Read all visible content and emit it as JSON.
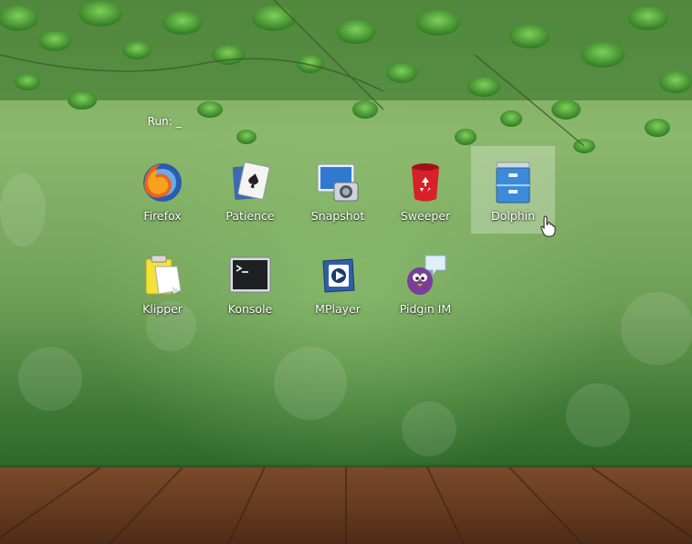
{
  "run_prompt": {
    "label": "Run:",
    "cursor": "_"
  },
  "apps": [
    {
      "name": "Firefox",
      "icon": "firefox-icon"
    },
    {
      "name": "Patience",
      "icon": "playing-card-icon"
    },
    {
      "name": "Snapshot",
      "icon": "camera-monitor-icon"
    },
    {
      "name": "Sweeper",
      "icon": "recycle-bin-icon"
    },
    {
      "name": "Dolphin",
      "icon": "file-cabinet-icon",
      "selected": true
    },
    {
      "name": "Klipper",
      "icon": "clipboard-icon"
    },
    {
      "name": "Konsole",
      "icon": "terminal-icon"
    },
    {
      "name": "MPlayer",
      "icon": "media-player-icon"
    },
    {
      "name": "Pidgin IM",
      "icon": "pidgin-bird-icon"
    }
  ]
}
